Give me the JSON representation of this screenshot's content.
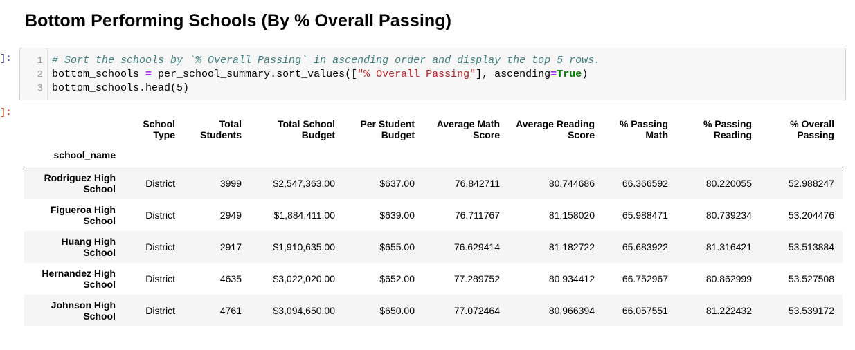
{
  "heading": "Bottom Performing Schools (By % Overall Passing)",
  "in_prompt": "]:",
  "out_prompt": "]:",
  "code": {
    "line_numbers": [
      "1",
      "2",
      "3"
    ],
    "line1_comment": "# Sort the schools by `% Overall Passing` in ascending order and display the top 5 rows.",
    "line2_a": "bottom_schools ",
    "line2_eq": "=",
    "line2_b": " per_school_summary.sort_values([",
    "line2_str": "\"% Overall Passing\"",
    "line2_c": "], ascending",
    "line2_eq2": "=",
    "line2_true": "True",
    "line2_d": ")",
    "line3": "bottom_schools.head(5)"
  },
  "table": {
    "columns": [
      [
        "School",
        "Type"
      ],
      [
        "Total",
        "Students"
      ],
      [
        "Total School",
        "Budget"
      ],
      [
        "Per Student",
        "Budget"
      ],
      [
        "Average Math",
        "Score"
      ],
      [
        "Average Reading",
        "Score"
      ],
      [
        "% Passing",
        "Math"
      ],
      [
        "% Passing",
        "Reading"
      ],
      [
        "% Overall",
        "Passing"
      ]
    ],
    "index_name": "school_name",
    "rows": [
      {
        "name": [
          "Rodriguez High",
          "School"
        ],
        "values": [
          "District",
          "3999",
          "$2,547,363.00",
          "$637.00",
          "76.842711",
          "80.744686",
          "66.366592",
          "80.220055",
          "52.988247"
        ]
      },
      {
        "name": [
          "Figueroa High",
          "School"
        ],
        "values": [
          "District",
          "2949",
          "$1,884,411.00",
          "$639.00",
          "76.711767",
          "81.158020",
          "65.988471",
          "80.739234",
          "53.204476"
        ]
      },
      {
        "name": [
          "Huang High",
          "School"
        ],
        "values": [
          "District",
          "2917",
          "$1,910,635.00",
          "$655.00",
          "76.629414",
          "81.182722",
          "65.683922",
          "81.316421",
          "53.513884"
        ]
      },
      {
        "name": [
          "Hernandez High",
          "School"
        ],
        "values": [
          "District",
          "4635",
          "$3,022,020.00",
          "$652.00",
          "77.289752",
          "80.934412",
          "66.752967",
          "80.862999",
          "53.527508"
        ]
      },
      {
        "name": [
          "Johnson High",
          "School"
        ],
        "values": [
          "District",
          "4761",
          "$3,094,650.00",
          "$650.00",
          "77.072464",
          "80.966394",
          "66.057551",
          "81.222432",
          "53.539172"
        ]
      }
    ]
  }
}
